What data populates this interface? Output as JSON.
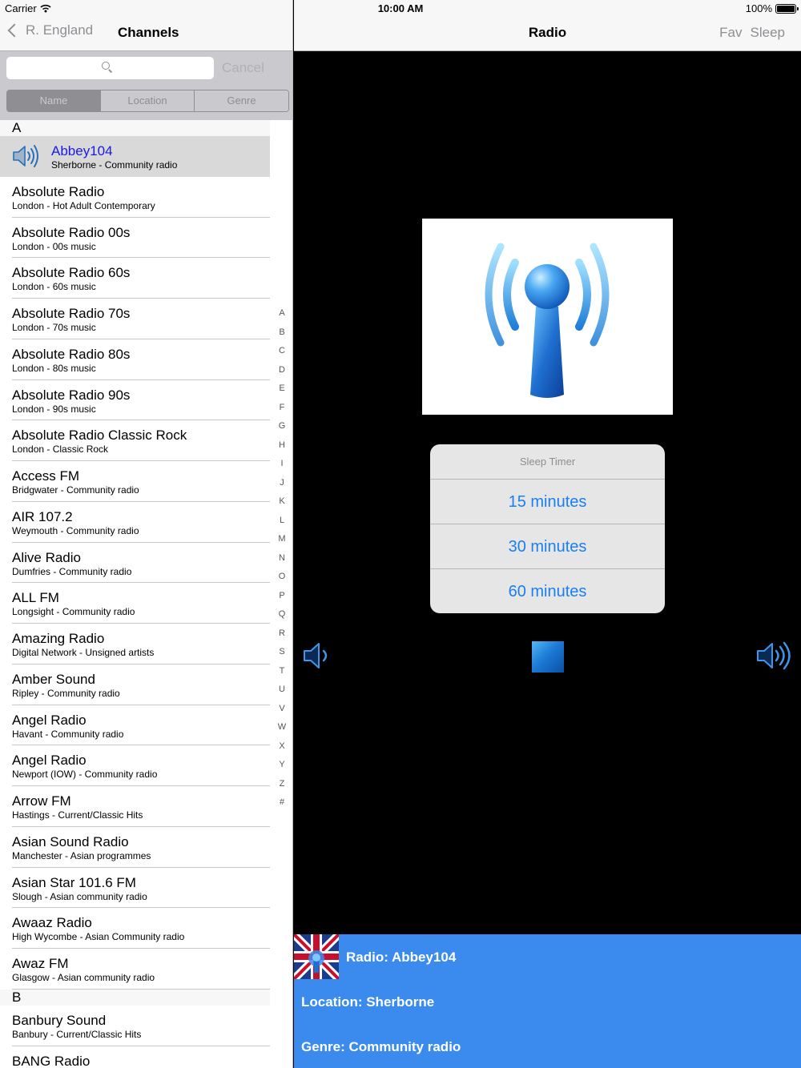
{
  "status": {
    "carrier": "Carrier",
    "time": "10:00 AM",
    "battery": "100%"
  },
  "left_nav": {
    "back_label": "R. England",
    "title": "Channels"
  },
  "search": {
    "placeholder": "",
    "cancel_label": "Cancel"
  },
  "scope_tabs": [
    "Name",
    "Location",
    "Genre"
  ],
  "scope_active": "Name",
  "sections": [
    {
      "header": "A",
      "rows": [
        {
          "title": "Abbey104",
          "subtitle": "Sherborne - Community radio",
          "selected": true
        },
        {
          "title": "Absolute Radio",
          "subtitle": "London - Hot Adult Contemporary"
        },
        {
          "title": "Absolute Radio 00s",
          "subtitle": "London - 00s music"
        },
        {
          "title": "Absolute Radio 60s",
          "subtitle": "London - 60s music"
        },
        {
          "title": "Absolute Radio 70s",
          "subtitle": "London - 70s music"
        },
        {
          "title": "Absolute Radio 80s",
          "subtitle": "London - 80s music"
        },
        {
          "title": "Absolute Radio 90s",
          "subtitle": "London - 90s music"
        },
        {
          "title": "Absolute Radio Classic Rock",
          "subtitle": "London - Classic Rock"
        },
        {
          "title": "Access FM",
          "subtitle": "Bridgwater - Community radio"
        },
        {
          "title": "AIR 107.2",
          "subtitle": "Weymouth - Community radio"
        },
        {
          "title": "Alive Radio",
          "subtitle": "Dumfries - Community radio"
        },
        {
          "title": "ALL FM",
          "subtitle": "Longsight - Community radio"
        },
        {
          "title": "Amazing Radio",
          "subtitle": "Digital Network - Unsigned artists"
        },
        {
          "title": "Amber Sound",
          "subtitle": "Ripley - Community radio"
        },
        {
          "title": "Angel Radio",
          "subtitle": "Havant - Community radio"
        },
        {
          "title": "Angel Radio",
          "subtitle": "Newport (IOW) - Community radio"
        },
        {
          "title": "Arrow FM",
          "subtitle": "Hastings - Current/Classic Hits"
        },
        {
          "title": "Asian Sound Radio",
          "subtitle": "Manchester - Asian programmes"
        },
        {
          "title": "Asian Star 101.6 FM",
          "subtitle": "Slough - Asian community radio"
        },
        {
          "title": "Awaaz Radio",
          "subtitle": "High Wycombe - Asian Community radio"
        },
        {
          "title": "Awaz FM",
          "subtitle": "Glasgow - Asian community radio"
        }
      ]
    },
    {
      "header": "B",
      "rows": [
        {
          "title": "Banbury Sound",
          "subtitle": "Banbury - Current/Classic Hits"
        },
        {
          "title": "BANG Radio",
          "subtitle": ""
        }
      ]
    }
  ],
  "index_letters": [
    "A",
    "B",
    "C",
    "D",
    "E",
    "F",
    "G",
    "H",
    "I",
    "J",
    "K",
    "L",
    "M",
    "N",
    "O",
    "P",
    "Q",
    "R",
    "S",
    "T",
    "U",
    "V",
    "W",
    "X",
    "Y",
    "Z",
    "#"
  ],
  "right_nav": {
    "title": "Radio",
    "fav_label": "Fav",
    "sleep_label": "Sleep"
  },
  "sleep_timer": {
    "title": "Sleep Timer",
    "options": [
      "15 minutes",
      "30 minutes",
      "60 minutes"
    ]
  },
  "now_playing": {
    "radio": "Radio: Abbey104",
    "location": "Location: Sherborne",
    "genre": "Genre: Community radio"
  },
  "icons": {
    "back": "chevron-left-icon",
    "search": "search-icon",
    "row_playing": "speaker-icon",
    "art": "radio-tower-icon",
    "volume_down": "volume-down-icon",
    "stop": "stop-icon",
    "volume_up": "volume-up-icon",
    "flag": "uk-flag-icon"
  },
  "colors": {
    "accent_blue": "#1a7ff0",
    "info_panel": "#3b8bee",
    "selected_row": "#d9d9d9",
    "selected_title": "#1a1ae6"
  }
}
